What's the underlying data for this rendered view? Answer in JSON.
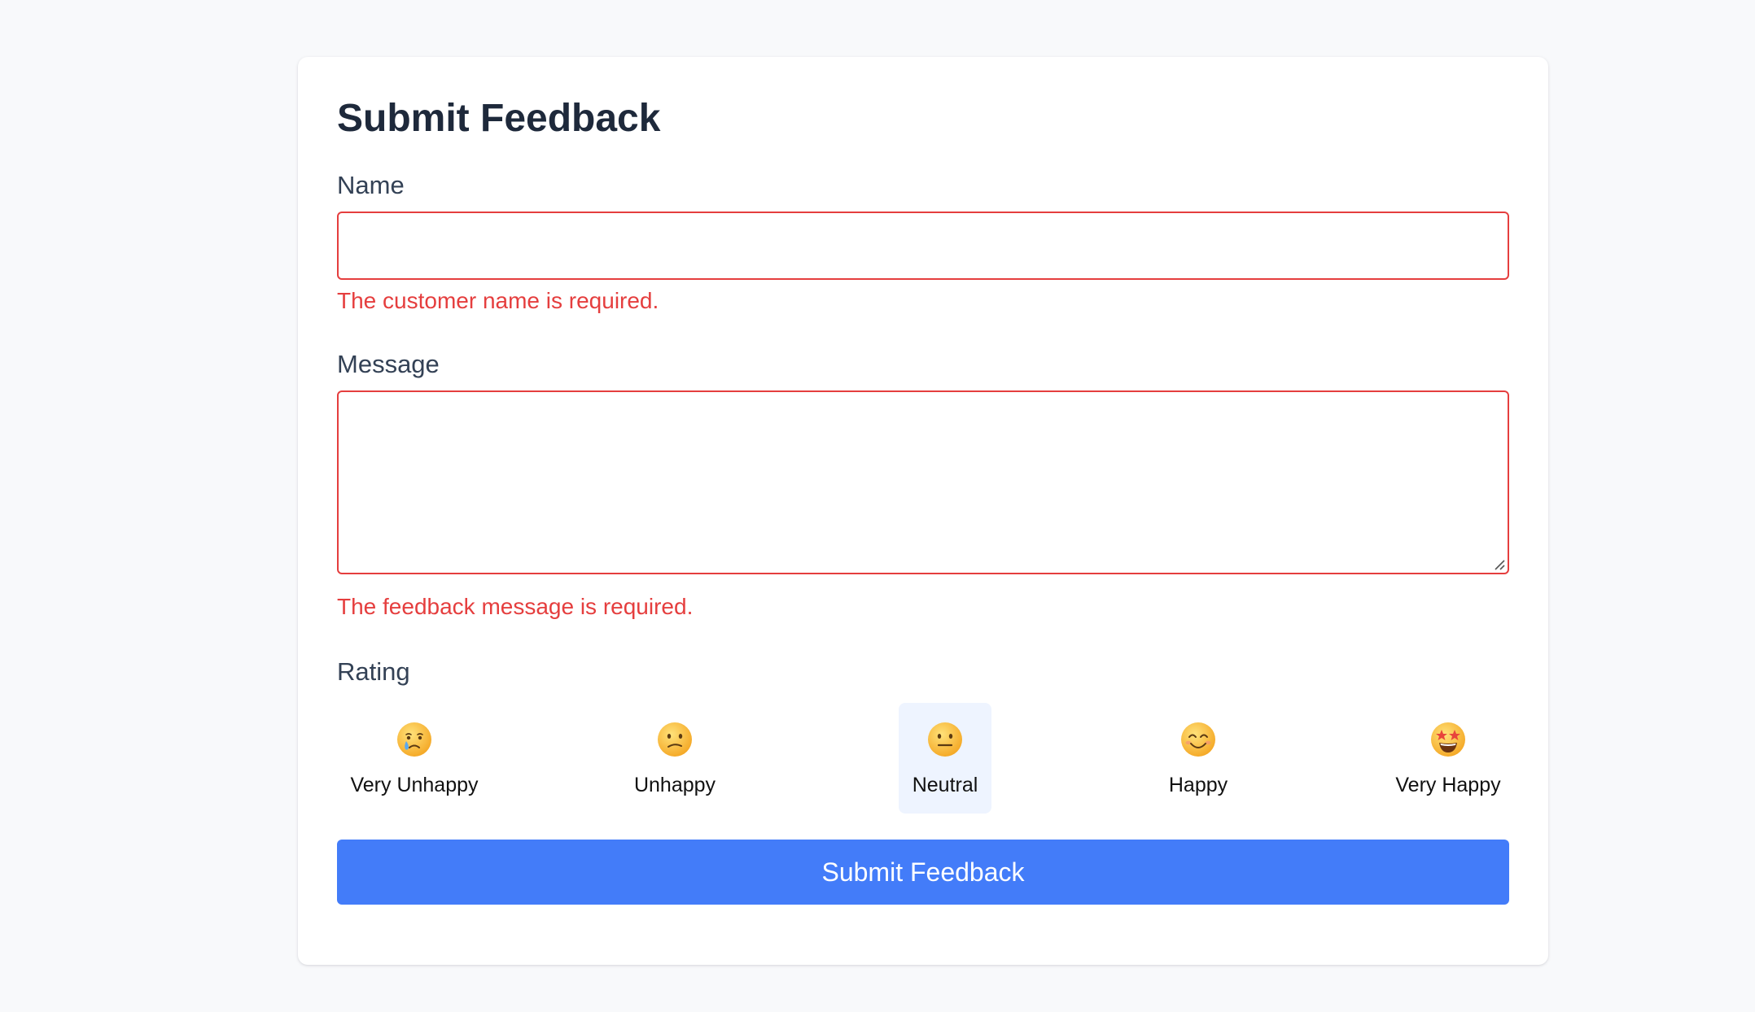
{
  "form": {
    "title": "Submit Feedback",
    "name_label": "Name",
    "name_value": "",
    "name_error": "The customer name is required.",
    "message_label": "Message",
    "message_value": "",
    "message_error": "The feedback message is required.",
    "rating_label": "Rating",
    "rating_options": [
      {
        "label": "Very Unhappy",
        "icon": "crying-face-icon",
        "selected": false
      },
      {
        "label": "Unhappy",
        "icon": "confused-face-icon",
        "selected": false
      },
      {
        "label": "Neutral",
        "icon": "neutral-face-icon",
        "selected": true
      },
      {
        "label": "Happy",
        "icon": "smiling-face-icon",
        "selected": false
      },
      {
        "label": "Very Happy",
        "icon": "star-struck-face-icon",
        "selected": false
      }
    ],
    "submit_label": "Submit Feedback"
  },
  "colors": {
    "background": "#f8f9fb",
    "card": "#ffffff",
    "title": "#1e293b",
    "label": "#334155",
    "error": "#e53e3e",
    "button": "#437cf9",
    "selected_rating_bg": "#eef4ff"
  }
}
